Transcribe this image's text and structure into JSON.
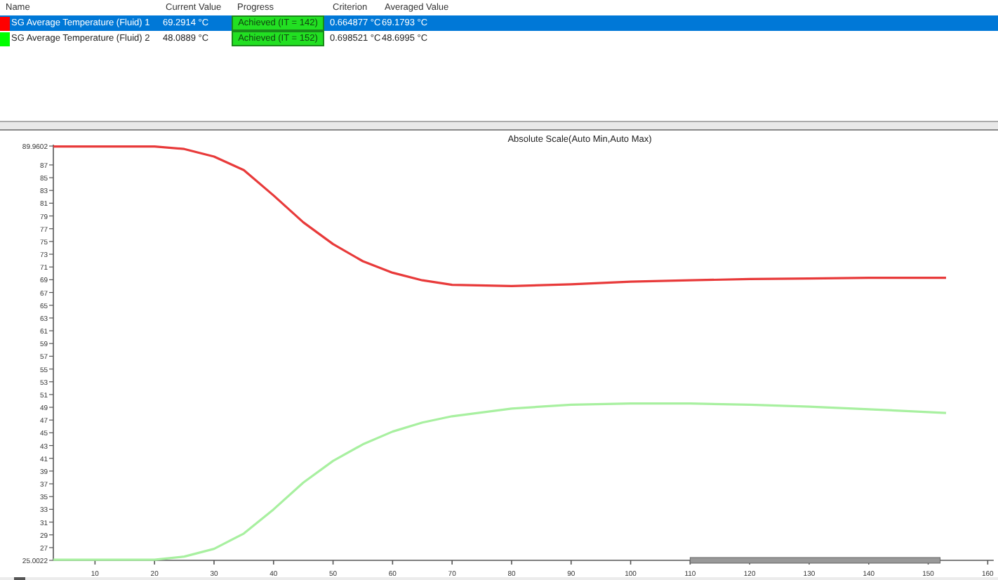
{
  "table": {
    "columns": [
      "Name",
      "Current Value",
      "Progress",
      "Criterion",
      "Averaged Value"
    ],
    "rows": [
      {
        "name": "SG Average Temperature (Fluid) 1",
        "color": "#ff0000",
        "selected": true,
        "current_value": "69.2914 °C",
        "progress": "Achieved (IT = 142)",
        "criterion": "0.664877 °C",
        "averaged_value": "69.1793 °C"
      },
      {
        "name": "SG Average Temperature (Fluid) 2",
        "color": "#00ff00",
        "selected": false,
        "current_value": "48.0889 °C",
        "progress": "Achieved (IT = 152)",
        "criterion": "0.698521 °C",
        "averaged_value": "48.6995 °C"
      }
    ]
  },
  "chart": {
    "chart_data": {
      "type": "line",
      "title": "Absolute Scale(Auto Min,Auto Max)",
      "x": [
        3,
        10,
        15,
        20,
        25,
        30,
        35,
        40,
        45,
        50,
        55,
        60,
        65,
        70,
        80,
        90,
        100,
        110,
        120,
        130,
        140,
        153
      ],
      "series": [
        {
          "color": "#e83a3a",
          "values": [
            89.9,
            89.9,
            89.9,
            89.9,
            89.5,
            88.3,
            86.2,
            82.2,
            78.0,
            74.6,
            71.9,
            70.1,
            68.9,
            68.2,
            68.0,
            68.3,
            68.7,
            68.9,
            69.1,
            69.2,
            69.3,
            69.3
          ]
        },
        {
          "color": "#a8f0a0",
          "values": [
            25.1,
            25.1,
            25.1,
            25.1,
            25.6,
            26.8,
            29.2,
            33.0,
            37.2,
            40.6,
            43.2,
            45.2,
            46.6,
            47.6,
            48.8,
            49.4,
            49.6,
            49.6,
            49.4,
            49.1,
            48.7,
            48.1
          ]
        }
      ],
      "xlim": [
        3,
        161
      ],
      "ylim": [
        25.0022,
        89.9602
      ],
      "xticks": [
        10,
        20,
        30,
        40,
        50,
        60,
        70,
        80,
        90,
        100,
        110,
        120,
        130,
        140,
        150,
        160
      ],
      "yticks": [
        {
          "value": 25.0022,
          "label": "25.0022"
        },
        27,
        29,
        31,
        33,
        35,
        37,
        39,
        41,
        43,
        45,
        47,
        49,
        51,
        53,
        55,
        57,
        59,
        61,
        63,
        65,
        67,
        69,
        71,
        73,
        75,
        77,
        79,
        81,
        83,
        85,
        87,
        {
          "value": 89.9602,
          "label": "89.9602"
        }
      ]
    }
  }
}
